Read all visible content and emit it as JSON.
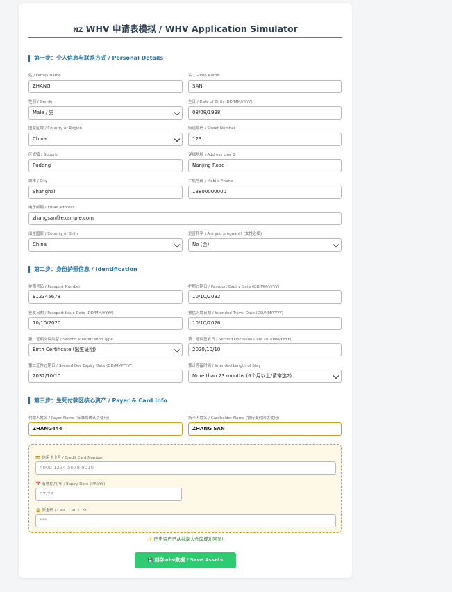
{
  "header": {
    "flag": "NZ",
    "title": "WHV 申请表模拟 / WHV Application Simulator"
  },
  "step1": {
    "title": "第一步：个人信息与联系方式 / Personal Details",
    "family_name": {
      "label": "姓 / Family Name",
      "value": "ZHANG"
    },
    "given_name": {
      "label": "名 / Given Name",
      "value": "SAN"
    },
    "gender": {
      "label": "性别 / Gender",
      "value": "Male / 男"
    },
    "dob": {
      "label": "生日 / Date of Birth (DD/MM/YYYY)",
      "value": "08/08/1998"
    },
    "country": {
      "label": "国家区域 / Country or Region",
      "value": "China"
    },
    "street": {
      "label": "街道号码 / Street Number",
      "value": "123"
    },
    "suburb": {
      "label": "区或镇 / Suburb",
      "value": "Pudong"
    },
    "address1": {
      "label": "详细地址 / Address Line 1",
      "value": "Nanjing Road"
    },
    "city": {
      "label": "城市 / City",
      "value": "Shanghai"
    },
    "mobile": {
      "label": "手机号码 / Mobile Phone",
      "value": "13800000000"
    },
    "email": {
      "label": "电子邮箱 / Email Address",
      "value": "zhangsan@example.com"
    },
    "birth_country": {
      "label": "出生国家 / Country of Birth",
      "value": "China"
    },
    "pregnant": {
      "label": "是否怀孕 / Are you pregnant? (女性必填)",
      "value": "No (否)"
    }
  },
  "step2": {
    "title": "第二步：身份护照信息 / Identification",
    "passport_no": {
      "label": "护照号码 / Passport Number",
      "value": "E12345678"
    },
    "passport_expiry": {
      "label": "护照过期日 / Passport Expiry Date (DD/MM/YYYY)",
      "value": "10/10/2032"
    },
    "passport_issue": {
      "label": "签发日期 / Passport Issue Date (DD/MM/YYYY)",
      "value": "10/10/2020"
    },
    "travel_date": {
      "label": "预估入境日期 / Intended Travel Date (DD/MM/YYYY)",
      "value": "10/10/2026"
    },
    "second_id_type": {
      "label": "第二证明文件类型 / Second Identification Type",
      "value": "Birth Certificate (出生证明)"
    },
    "second_issue": {
      "label": "第二证件签发日 / Second Doc Issue Date (DD/MM/YYYY)",
      "value": "2020/10/10"
    },
    "second_expiry": {
      "label": "第二证件过期日 / Second Doc Expiry Date (DD/MM/YYYY)",
      "value": "2032/10/10"
    },
    "stay_length": {
      "label": "预计停留时间 / Intended Length of Stay",
      "value": "More than 23 months (6个月以上/请常选2)"
    }
  },
  "step3": {
    "title": "第三步：生死付款区核心资产 / Payer & Card Info",
    "payer": {
      "label": "付款人姓名 / Payer Name (标准局确认页使用)",
      "value": "ZHANG444"
    },
    "cardholder": {
      "label": "持卡人姓名 / Cardholder Name (银行支付网关使用)",
      "value": "ZHANG SAN"
    },
    "card_number": {
      "label": "信用卡卡号 / Credit Card Number",
      "placeholder": "4000 1234 5678 9010"
    },
    "expiry": {
      "label": "有效期月/年 / Expiry Date (MM/YY)",
      "placeholder": "07/29"
    },
    "cvv": {
      "label": "安全码 / CVV / CVC / CSC",
      "placeholder": "***"
    }
  },
  "status_message": "历史资产已从共享大仓库成功回显!",
  "save_button": "刻存whv数据 / Save Assets",
  "colors": {
    "accent": "#2471a3",
    "button": "#2ecc71",
    "highlight_border": "#d4a017",
    "card_area_bg": "#fef9e7",
    "message": "#2e7d32"
  },
  "icons": {
    "card": "credit-card-icon",
    "calendar": "calendar-icon",
    "lock": "lock-icon",
    "sparkle": "sparkle-icon",
    "save": "save-icon"
  }
}
